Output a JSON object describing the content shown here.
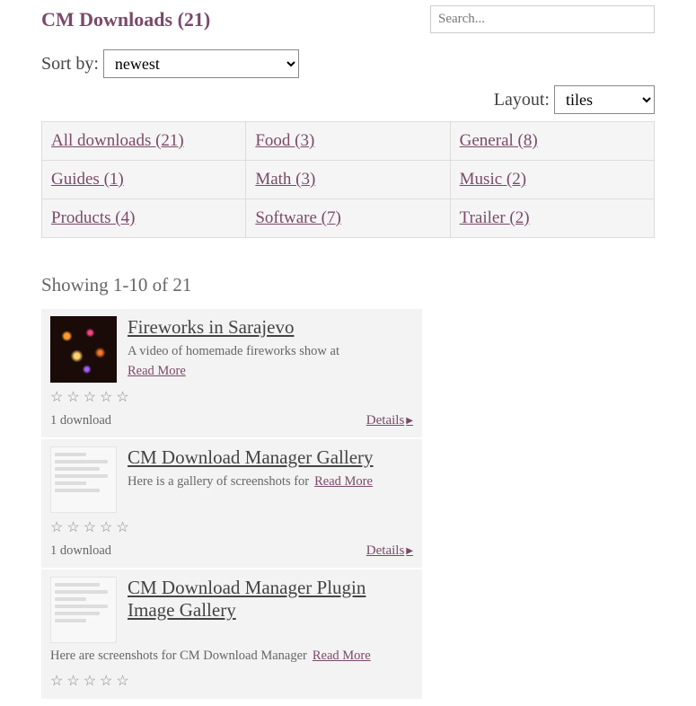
{
  "title": "CM Downloads (21)",
  "search_placeholder": "Search...",
  "sort": {
    "label": "Sort by:",
    "value": "newest"
  },
  "layout": {
    "label": "Layout:",
    "value": "tiles"
  },
  "categories": [
    {
      "label": "All downloads (21)"
    },
    {
      "label": "Food (3)"
    },
    {
      "label": "General (8)"
    },
    {
      "label": "Guides (1)"
    },
    {
      "label": "Math (3)"
    },
    {
      "label": "Music (2)"
    },
    {
      "label": "Products (4)"
    },
    {
      "label": "Software (7)"
    },
    {
      "label": "Trailer (2)"
    }
  ],
  "showing": "Showing 1-10 of 21",
  "read_more": "Read More",
  "details": "Details",
  "items": [
    {
      "title": "Fireworks in Sarajevo",
      "desc": "A video of homemade fireworks show at",
      "downloads": "1 download"
    },
    {
      "title": "CM Download Manager Gallery",
      "desc": "Here is a gallery of screenshots for",
      "downloads": "1 download"
    },
    {
      "title": "CM Download Manager Plugin Image Gallery",
      "desc": "Here are screenshots for CM Download Manager",
      "downloads": ""
    }
  ]
}
